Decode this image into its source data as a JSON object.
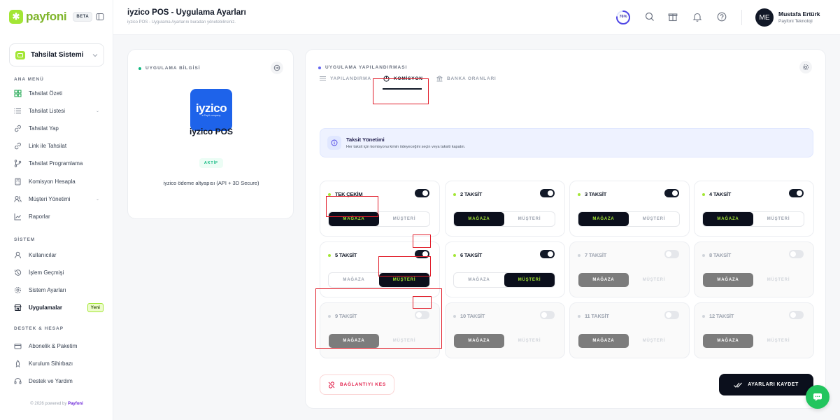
{
  "brand": {
    "name": "payfoni",
    "badge": "BETA",
    "logo_icon": "asterisk-icon"
  },
  "system_select": {
    "label": "Tahsilat Sistemi"
  },
  "nav": {
    "main_title": "ANA MENÜ",
    "main_items": [
      {
        "label": "Tahsilat Özeti",
        "icon": "grid-icon"
      },
      {
        "label": "Tahsilat Listesi",
        "icon": "list-icon",
        "chevron": "⌄"
      },
      {
        "label": "Tahsilat Yap",
        "icon": "link-icon"
      },
      {
        "label": "Link ile Tahsilat",
        "icon": "link-icon"
      },
      {
        "label": "Tahsilat Programlama",
        "icon": "branch-icon"
      },
      {
        "label": "Komisyon Hesapla",
        "icon": "calculator-icon"
      },
      {
        "label": "Müşteri Yönetimi",
        "icon": "users-icon",
        "chevron": "⌄"
      },
      {
        "label": "Raporlar",
        "icon": "chart-icon"
      }
    ],
    "system_title": "SİSTEM",
    "system_items": [
      {
        "label": "Kullanıcılar",
        "icon": "user-icon"
      },
      {
        "label": "İşlem Geçmişi",
        "icon": "history-icon"
      },
      {
        "label": "Sistem Ayarları",
        "icon": "gear-icon"
      },
      {
        "label": "Uygulamalar",
        "icon": "store-icon",
        "badge": "Yeni",
        "active": true
      }
    ],
    "support_title": "DESTEK & HESAP",
    "support_items": [
      {
        "label": "Abonelik & Paketim",
        "icon": "card-icon"
      },
      {
        "label": "Kurulum Sihirbazı",
        "icon": "wizard-icon"
      },
      {
        "label": "Destek ve Yardım",
        "icon": "headset-icon"
      }
    ],
    "powered_prefix": "© 2026 powered by",
    "powered_brand": "Payfoni"
  },
  "header": {
    "title": "iyzico POS - Uygulama Ayarları",
    "subtitle": "iyzico POS - Uygulama Ayarlarını buradan yönetebilirsiniz.",
    "progress_label": "76%",
    "progress_value": 0.76,
    "user_initials": "ME",
    "user_name": "Mustafa Ertürk",
    "user_company": "Payfoni Teknoloji"
  },
  "app_info": {
    "section_title": "UYGULAMA BİLGİSİ",
    "logo_text": "iyzico",
    "logo_tagline": "a PayU company",
    "name": "iyzico POS",
    "status": "AKTİF",
    "description": "iyzico ödeme altyapısı (API + 3D Secure)"
  },
  "config": {
    "section_title": "UYGULAMA YAPILANDIRMASI",
    "tabs": [
      {
        "label": "YAPILANDIRMA",
        "icon": "sliders-icon"
      },
      {
        "label": "KOMİSYON",
        "icon": "pie-icon",
        "active": true
      },
      {
        "label": "BANKA ORANLARI",
        "icon": "bank-icon"
      }
    ],
    "info_title": "Taksit Yönetimi",
    "info_desc": "Her taksit için komisyonu kimin ödeyeceğini seçin veya taksiti kapatın.",
    "option_store": "MAĞAZA",
    "option_customer": "MÜŞTERİ",
    "installments": [
      {
        "label": "TEK ÇEKİM",
        "enabled": true,
        "payer": "store"
      },
      {
        "label": "2 TAKSİT",
        "enabled": true,
        "payer": "store"
      },
      {
        "label": "3 TAKSİT",
        "enabled": true,
        "payer": "store"
      },
      {
        "label": "4 TAKSİT",
        "enabled": true,
        "payer": "store"
      },
      {
        "label": "5 TAKSİT",
        "enabled": true,
        "payer": "customer"
      },
      {
        "label": "6 TAKSİT",
        "enabled": true,
        "payer": "customer"
      },
      {
        "label": "7 TAKSİT",
        "enabled": false,
        "payer": "store"
      },
      {
        "label": "8 TAKSİT",
        "enabled": false,
        "payer": "store"
      },
      {
        "label": "9 TAKSİT",
        "enabled": false,
        "payer": "store"
      },
      {
        "label": "10 TAKSİT",
        "enabled": false,
        "payer": "store"
      },
      {
        "label": "11 TAKSİT",
        "enabled": false,
        "payer": "store"
      },
      {
        "label": "12 TAKSİT",
        "enabled": false,
        "payer": "store"
      }
    ],
    "disconnect_label": "BAĞLANTIYI KES",
    "save_label": "AYARLARI KAYDET"
  },
  "colors": {
    "accent": "#a3e635",
    "dark": "#0b0f1c",
    "danger": "#e11d2a",
    "active_dot": "#a3e635",
    "info_dot": "#10b981",
    "config_dot": "#6366f1"
  }
}
